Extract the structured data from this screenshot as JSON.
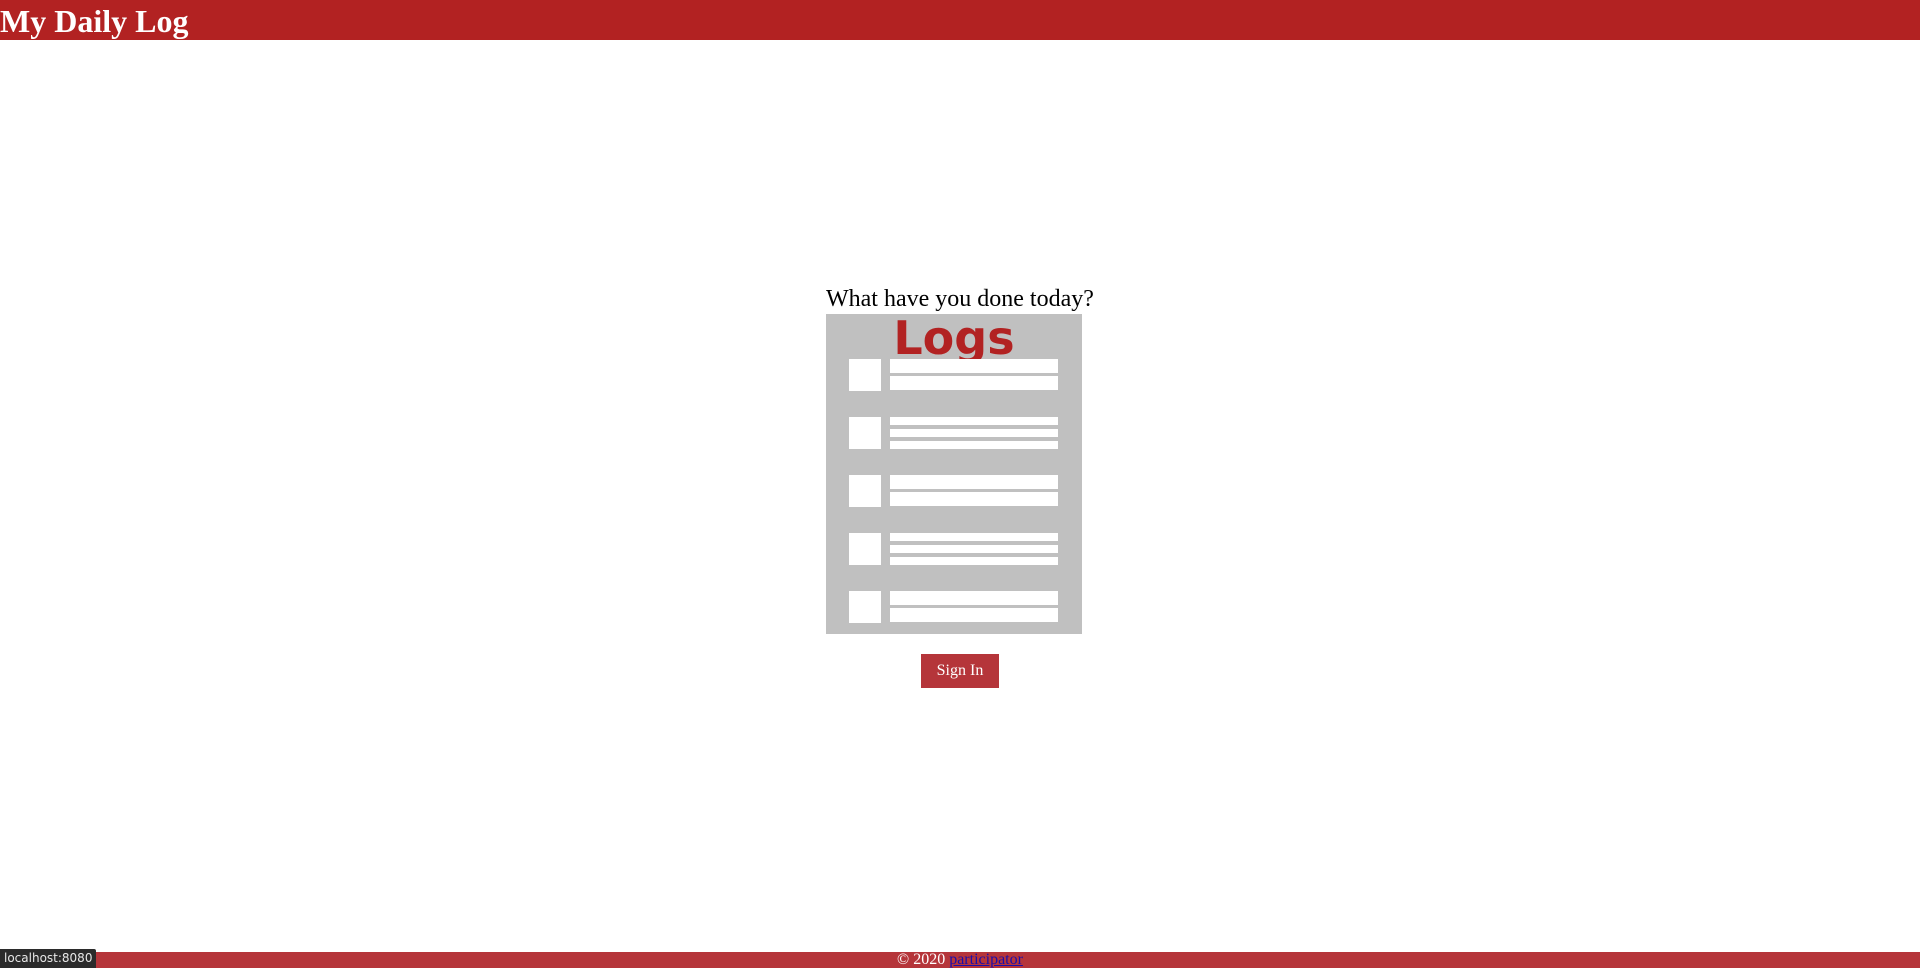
{
  "header": {
    "title": "My Daily Log"
  },
  "main": {
    "prompt": "What have you done today?",
    "logo_text": "Logs",
    "signin_label": "Sign In"
  },
  "footer": {
    "copyright": "© 2020",
    "author_link": "participator"
  },
  "status_bar": {
    "url": "localhost:8080"
  },
  "colors": {
    "brand": "#b22222",
    "button": "#b5353a",
    "logo_bg": "#c0c0c0"
  }
}
